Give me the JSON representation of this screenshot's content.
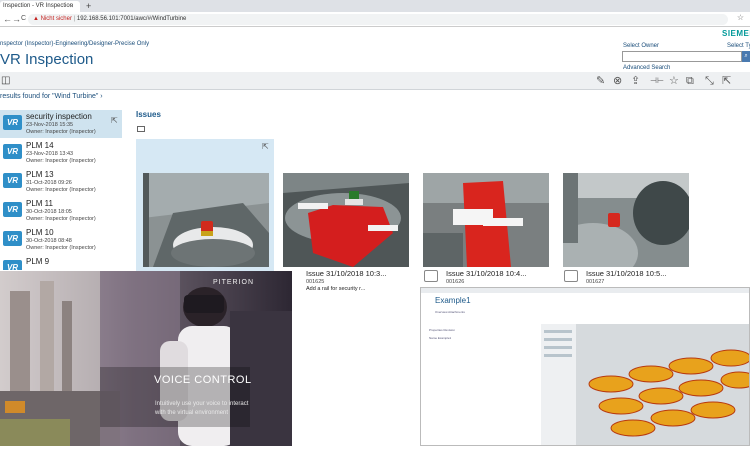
{
  "browser": {
    "tab_title": "Inspection - VR Inspection",
    "tab_close": "×",
    "tab_new": "+",
    "back": "←",
    "forward": "→",
    "reload": "C",
    "warning_icon": "▲",
    "not_secure": "Nicht sicher",
    "url": "192.168.56.101:7001/awc/#/WindTurbine",
    "star_icon": "☆"
  },
  "header": {
    "breadcrumb": "nspector (Inspector)-Engineering/Designer-Precise Only",
    "title": "VR Inspection",
    "brand": "SIEMENS",
    "select_owner": "Select Owner",
    "select_type": "Select Ty",
    "search_icon": "⌕",
    "advanced_search": "Advanced Search"
  },
  "toolbar": {
    "left_icon": "◫",
    "icons": [
      "✎",
      "⊗",
      "⇪",
      "⊣⊢",
      "☆",
      "⧉",
      "⤡",
      "⇱"
    ]
  },
  "results_text": "results found for \"Wind Turbine\" ›",
  "list": {
    "logo_text": "VR",
    "open_icon": "⇱",
    "items": [
      {
        "title": "security inspection",
        "date": "23-Nov-2018 15:35",
        "owner": "Owner: Inspector (Inspector)",
        "selected": true
      },
      {
        "title": "PLM 14",
        "date": "23-Nov-2018 13:43",
        "owner": "Owner: Inspector (Inspector)"
      },
      {
        "title": "PLM 13",
        "date": "31-Oct-2018 09:26",
        "owner": "Owner: Inspector (Inspector)"
      },
      {
        "title": "PLM 11",
        "date": "30-Oct-2018 18:05",
        "owner": "Owner: Inspector (Inspector)"
      },
      {
        "title": "PLM 10",
        "date": "30-Oct-2018 08:48",
        "owner": "Owner: Inspector (Inspector)"
      },
      {
        "title": "PLM 9",
        "date": "",
        "owner": ""
      }
    ]
  },
  "issues": {
    "heading": "Issues",
    "open_icon": "⇱",
    "cards": [
      {
        "title": "",
        "id": "",
        "desc": ""
      },
      {
        "title": "Issue 31/10/2018 10:3...",
        "id": "001625",
        "desc": "Add a rail for security r..."
      },
      {
        "title": "Issue 31/10/2018 10:4...",
        "id": "001626",
        "desc": ""
      },
      {
        "title": "Issue 31/10/2018 10:5...",
        "id": "001627",
        "desc": ""
      }
    ]
  },
  "video": {
    "brand": "PITERION",
    "title": "VOICE CONTROL",
    "line1": "Intuitively use your voice to interact",
    "line2": "with the virtual environment"
  },
  "shot2": {
    "title": "Example1",
    "tiny_1": "Overview   Attachments",
    "tiny_2": "Properties   Revision",
    "tiny_3": "Name   Example1"
  },
  "colors": {
    "accent": "#1e5a8a",
    "brand": "#009999",
    "selected_bg": "#cfe3ef",
    "vr_logo": "#2f8fc8"
  }
}
